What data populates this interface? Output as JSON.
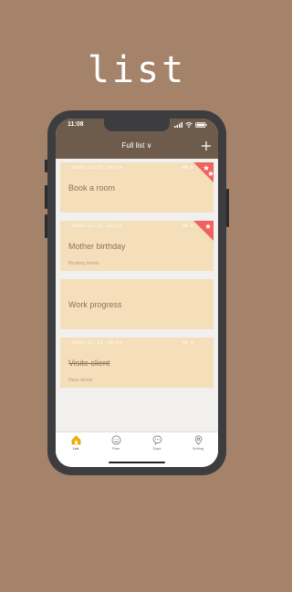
{
  "hero": {
    "title": "list"
  },
  "status": {
    "time": "11:08"
  },
  "nav": {
    "title": "Full list ∨",
    "add_icon": "plus-icon"
  },
  "cards": [
    {
      "date": "2020/11/21 10:14",
      "left": "43 h",
      "title": "Book a room",
      "note": "",
      "done": false,
      "stars": 2
    },
    {
      "date": "2020/11/21 10:14",
      "left": "43 h",
      "title": "Mother birthday",
      "note": "Booking tickets",
      "done": false,
      "stars": 1
    },
    {
      "date": "",
      "left": "",
      "title": "Work progress",
      "note": "",
      "done": false,
      "stars": 0
    },
    {
      "date": "2020/11/21 10:14",
      "left": "43 h",
      "title": "Visite client",
      "note": "Have dinner",
      "done": true,
      "stars": 0
    }
  ],
  "tabs": [
    {
      "label": "List",
      "icon": "home-icon",
      "active": true
    },
    {
      "label": "Plan",
      "icon": "smiley-icon",
      "active": false
    },
    {
      "label": "Days",
      "icon": "chat-bubble-icon",
      "active": false
    },
    {
      "label": "Setting",
      "icon": "location-pin-icon",
      "active": false
    }
  ],
  "colors": {
    "background": "#a5836a",
    "nav": "#6d5c4c",
    "card": "#f4dfba",
    "card_title": "#8f7256",
    "ribbon": "#f0625e",
    "active_tab": "#f4b400"
  }
}
